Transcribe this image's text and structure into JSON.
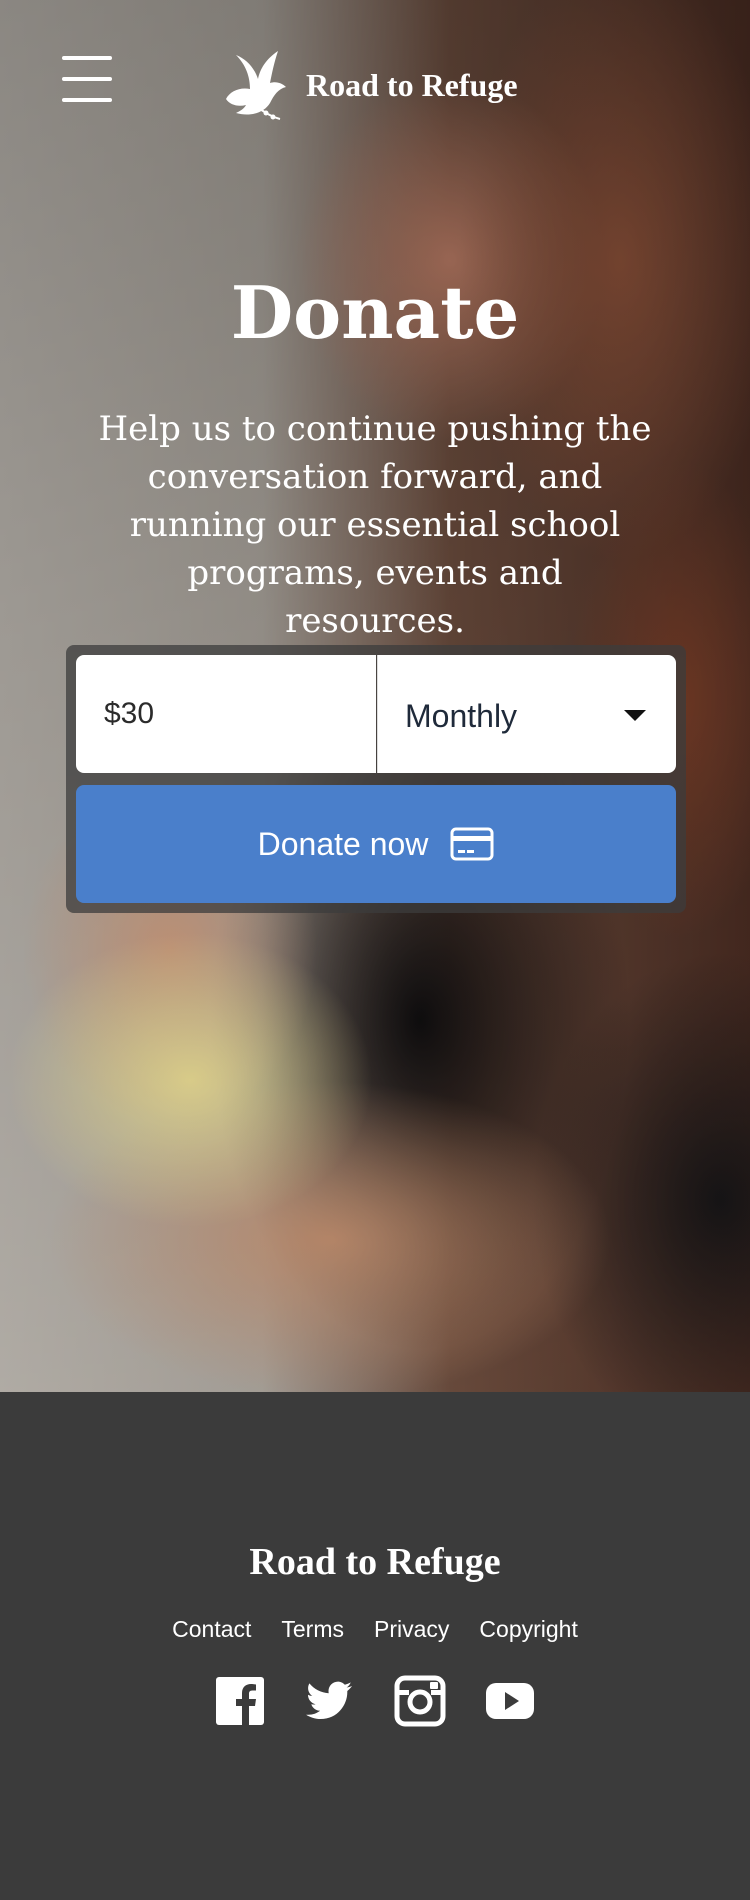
{
  "header": {
    "brand_name": "Road to Refuge",
    "menu_icon": "hamburger-menu-icon",
    "logo_icon": "dove-icon"
  },
  "hero": {
    "title": "Donate",
    "description": "Help us to continue pushing the conversation forward, and running our essential school programs, events and resources."
  },
  "donation_form": {
    "amount_value": "$30",
    "frequency_selected": "Monthly",
    "donate_button_label": "Donate now",
    "button_color": "#4a7fcb",
    "button_icon": "credit-card-icon"
  },
  "footer": {
    "brand_name": "Road to Refuge",
    "links": [
      "Contact",
      "Terms",
      "Privacy",
      "Copyright"
    ],
    "social_icons": [
      "facebook-icon",
      "twitter-icon",
      "instagram-icon",
      "youtube-icon"
    ],
    "background_color": "#3b3b3b"
  }
}
